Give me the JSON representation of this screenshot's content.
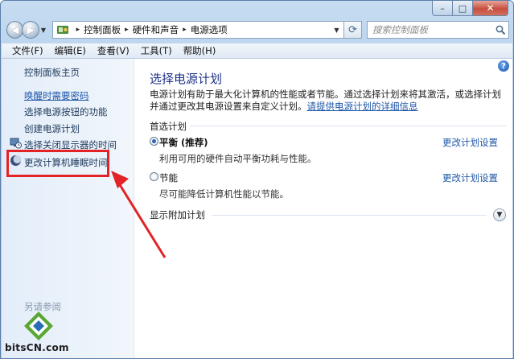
{
  "window": {
    "caption_buttons": {
      "minimize": "–",
      "maximize": "□",
      "close": "✕"
    }
  },
  "navbar": {
    "breadcrumbs": [
      "控制面板",
      "硬件和声音",
      "电源选项"
    ],
    "search_placeholder": "搜索控制面板"
  },
  "menu": [
    "文件(F)",
    "编辑(E)",
    "查看(V)",
    "工具(T)",
    "帮助(H)"
  ],
  "sidebar": {
    "home": "控制面板主页",
    "links": [
      {
        "label": "唤醒时需要密码",
        "underlined": true,
        "icon": null
      },
      {
        "label": "选择电源按钮的功能",
        "underlined": false,
        "icon": null
      },
      {
        "label": "创建电源计划",
        "underlined": false,
        "icon": null
      },
      {
        "label": "选择关闭显示器的时间",
        "underlined": false,
        "icon": "monitor-clock-icon"
      },
      {
        "label": "更改计算机睡眠时间",
        "underlined": false,
        "icon": "moon-icon"
      }
    ],
    "see_also": "另请参阅"
  },
  "main": {
    "title": "选择电源计划",
    "description": "电源计划有助于最大化计算机的性能或者节能。通过选择计划来将其激活，或选择计划并通过更改其电源设置来自定义计划。",
    "description_link": "请提供电源计划的详细信息",
    "section_label": "首选计划",
    "plans": [
      {
        "name": "平衡 (推荐)",
        "desc": "利用可用的硬件自动平衡功耗与性能。",
        "checked": true,
        "link": "更改计划设置"
      },
      {
        "name": "节能",
        "desc": "尽可能降低计算机性能以节能。",
        "checked": false,
        "link": "更改计划设置"
      }
    ],
    "extra_plans_label": "显示附加计划"
  },
  "annotation": {
    "highlight_color": "#e32326"
  },
  "watermark": "bitsCN.com"
}
